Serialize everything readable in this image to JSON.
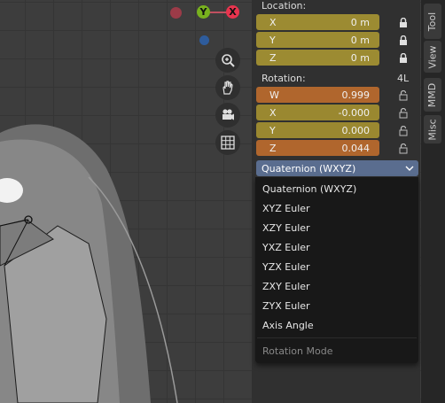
{
  "gizmo": {
    "y_label": "Y",
    "x_label": "X",
    "colors": {
      "x": "#e8344e",
      "y": "#78b11e",
      "neg_x": "#9b3b48",
      "neg_z": "#2e5c9c"
    }
  },
  "nav_tools": [
    "zoom-icon",
    "hand-icon",
    "camera-icon",
    "grid-icon"
  ],
  "panel": {
    "location_label": "Location:",
    "location": [
      {
        "axis": "X",
        "value": "0 m"
      },
      {
        "axis": "Y",
        "value": "0 m"
      },
      {
        "axis": "Z",
        "value": "0 m"
      }
    ],
    "rotation_label": "Rotation:",
    "rotation_badge": "4L",
    "rotation": [
      {
        "axis": "W",
        "value": "0.999"
      },
      {
        "axis": "X",
        "value": "-0.000"
      },
      {
        "axis": "Y",
        "value": "0.000"
      },
      {
        "axis": "Z",
        "value": "0.044"
      }
    ],
    "mode_selected": "Quaternion (WXYZ)"
  },
  "dropdown": {
    "items": [
      "Quaternion (WXYZ)",
      "XYZ Euler",
      "XZY Euler",
      "YXZ Euler",
      "YZX Euler",
      "ZXY Euler",
      "ZYX Euler",
      "Axis Angle"
    ],
    "title": "Rotation Mode"
  },
  "tabs": [
    "Tool",
    "View",
    "MMD",
    "Misc"
  ]
}
